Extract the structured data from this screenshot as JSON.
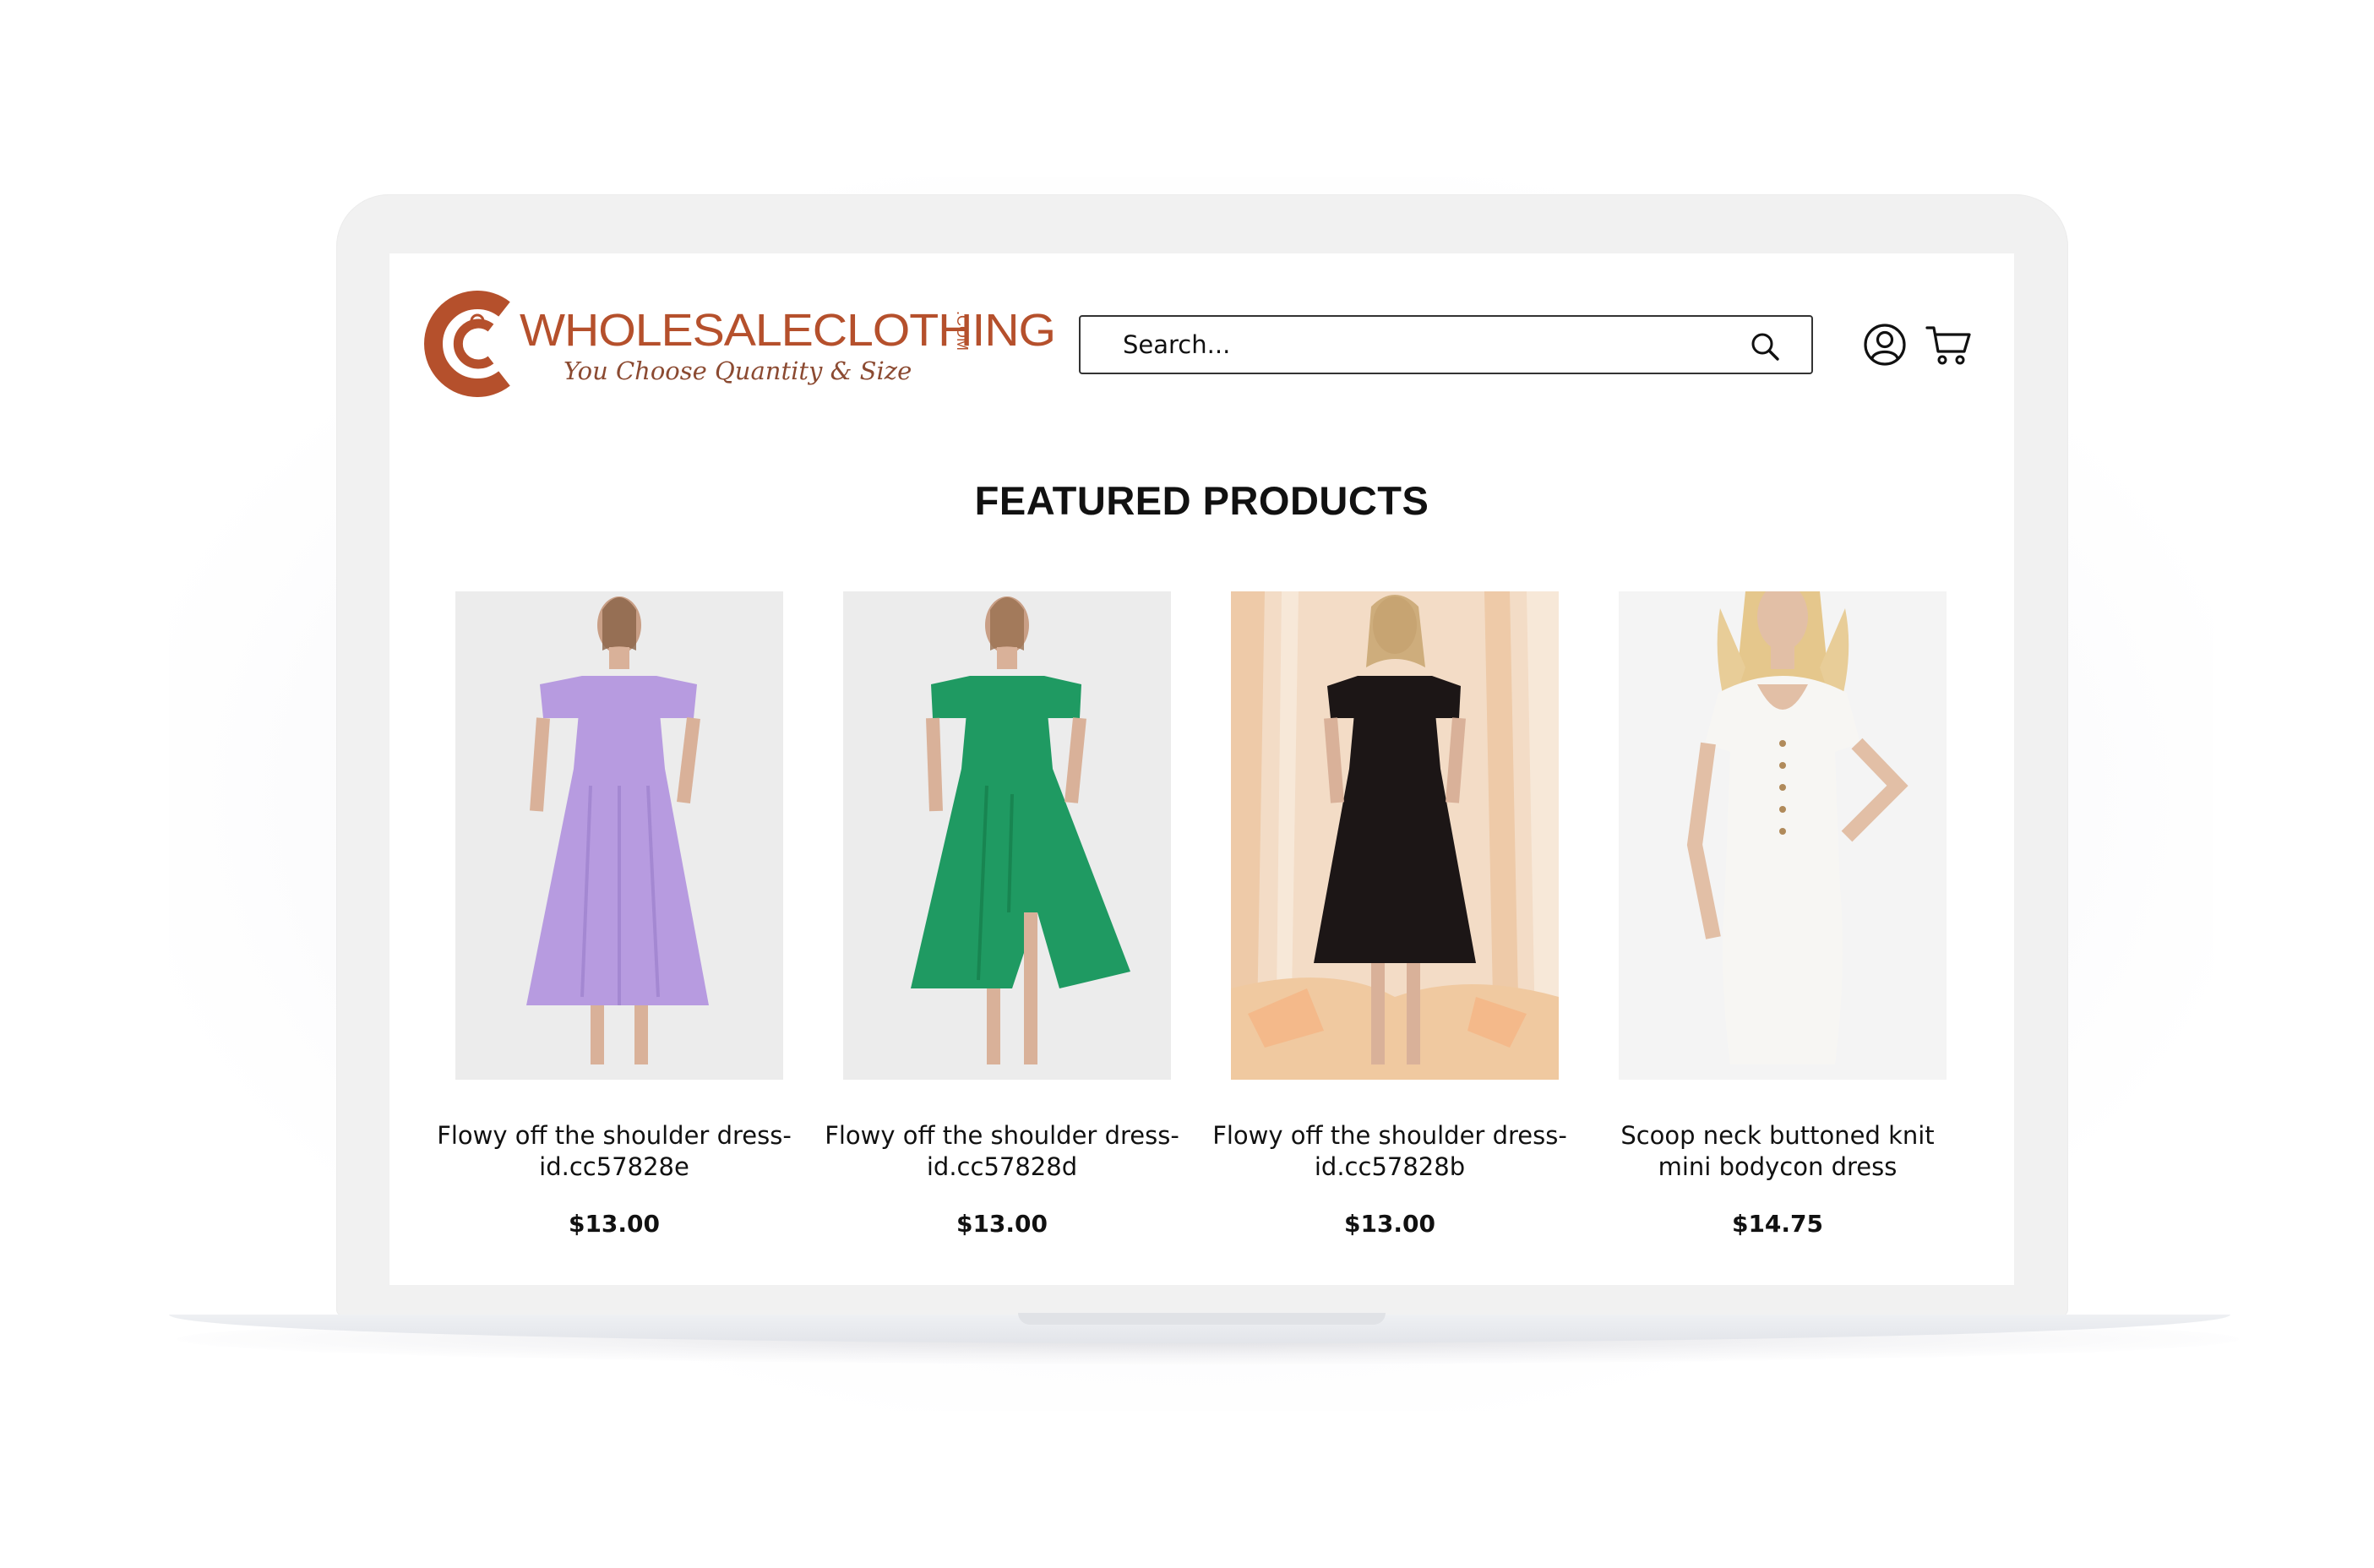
{
  "brand": {
    "logo_main": "WHOLESALECLOTHING",
    "logo_suffix": ".COM",
    "tagline": "You Choose Quantity & Size",
    "color": "#b5502c"
  },
  "header": {
    "search_placeholder": "Search...",
    "search_icon": "search-icon",
    "account_icon": "user-icon",
    "cart_icon": "cart-icon"
  },
  "featured": {
    "title": "FEATURED PRODUCTS",
    "products": [
      {
        "name": "Flowy off the shoulder dress-id.cc57828e",
        "line1": "Flowy off the shoulder dress-",
        "line2": "id.cc57828e",
        "price": "$13.00",
        "color": "#b79be0",
        "bg": "#ececec"
      },
      {
        "name": "Flowy off the shoulder dress-id.cc57828d",
        "line1": "Flowy off the shoulder dress-",
        "line2": "id.cc57828d",
        "price": "$13.00",
        "color": "#1f9a62",
        "bg": "#ececec"
      },
      {
        "name": "Flowy off the shoulder dress-id.cc57828b",
        "line1": "Flowy off the shoulder dress-",
        "line2": "id.cc57828b",
        "price": "$13.00",
        "color": "#1c1616",
        "bg": "#f1d8c2"
      },
      {
        "name": "Scoop neck buttoned knit mini bodycon dress",
        "line1": "Scoop neck buttoned knit",
        "line2": "mini bodycon dress",
        "price": "$14.75",
        "color": "#f7f6f3",
        "bg": "#f4f4f4"
      }
    ]
  }
}
